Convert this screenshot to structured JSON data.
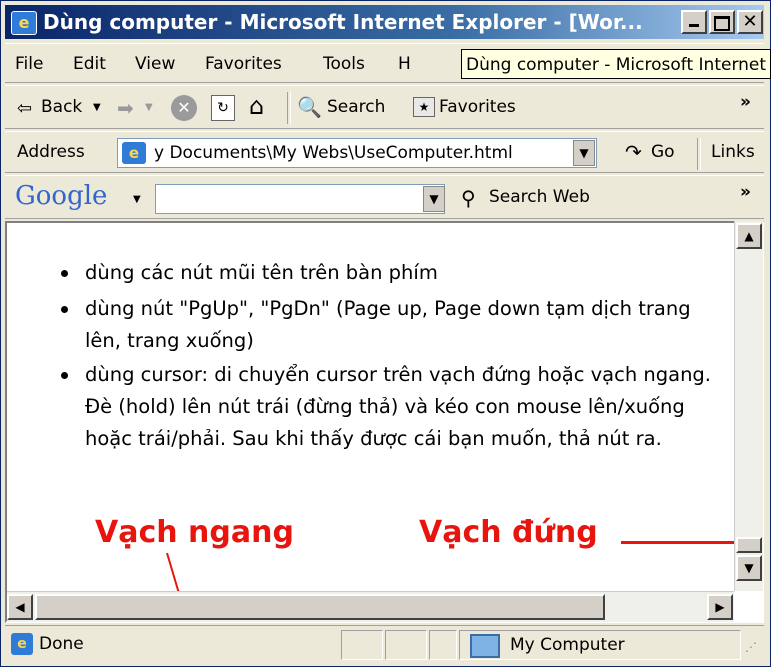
{
  "window": {
    "title": "Dùng computer - Microsoft Internet Explorer - [Wor...",
    "tooltip": "Dùng computer - Microsoft Internet Explorer"
  },
  "menu": {
    "items": [
      "File",
      "Edit",
      "View",
      "Favorites",
      "Tools",
      "H"
    ]
  },
  "toolbar": {
    "back_label": "Back",
    "search_label": "Search",
    "favorites_label": "Favorites",
    "overflow": "»"
  },
  "address": {
    "label": "Address",
    "value": "y Documents\\My Webs\\UseComputer.html",
    "go_label": "Go",
    "links_label": "Links"
  },
  "google": {
    "logo": "Google",
    "search_value": "",
    "search_web_label": "Search Web",
    "overflow": "»"
  },
  "content": {
    "bullets": [
      "dùng các nút mũi tên trên bàn phím",
      "dùng nút \"PgUp\", \"PgDn\" (Page up, Page down tạm dịch trang lên, trang xuống)",
      "dùng cursor:  di chuyển cursor trên vạch đứng hoặc vạch ngang.  Đè (hold) lên nút trái (đừng thả) và kéo con mouse lên/xuống hoặc trái/phải.  Sau khi thấy được cái bạn muốn, thả nút ra."
    ],
    "annotations": {
      "horizontal": "Vạch ngang",
      "vertical": "Vạch đứng"
    }
  },
  "status": {
    "left": "Done",
    "zone": "My Computer"
  },
  "colors": {
    "annotation": "#e8150f",
    "title_bar": "#0a246a"
  }
}
